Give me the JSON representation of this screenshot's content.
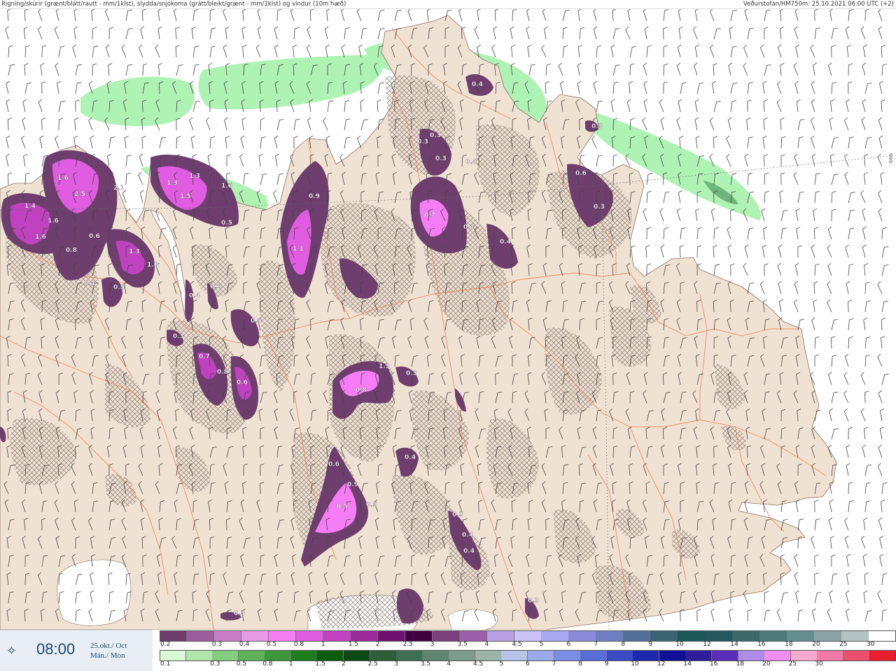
{
  "header": {
    "left": "Rigning/skúrir (grænt/blátt/rautt - mm/1klst), slydda/snjókoma (grátt/bleikt/grænt - mm/1klst) og vindur (10m hæð)",
    "right": "Veðurstofan/HM750m: 25.10.2021 06:00 UTC (+2)"
  },
  "lat_label": "66N",
  "time": {
    "icon": "sun-compass-icon",
    "clock": "08:00",
    "date_line1": "25.okt./ Oct",
    "date_line2": "Mán./ Mon"
  },
  "colors": {
    "land": "#f0e2d3",
    "sea": "#ffffff",
    "rain_green": "#aef2b4",
    "snow_purple": "#b24ac8",
    "roads": "#f07a4e"
  },
  "legend_snow": {
    "colors": [
      "#6e3f6e",
      "#9b5d9b",
      "#c77ec7",
      "#e59be5",
      "#f77df7",
      "#e05ce0",
      "#c042c0",
      "#9b2a9b",
      "#6e116e",
      "#410041",
      "#7b3f7b",
      "#9a5fa8",
      "#b8a0e2",
      "#c9c3f6",
      "#a8a8ef",
      "#8a8ad8",
      "#6e7fc1",
      "#53709b",
      "#3b6473",
      "#1e5758",
      "#25575f",
      "#3c6868",
      "#4f7a7a",
      "#658e8e",
      "#8ba3a3",
      "#b3c2c2",
      "#ffffff"
    ],
    "labels": [
      "0.2",
      "0.3",
      "0.4",
      "0.5",
      "0.8",
      "1",
      "1.5",
      "2",
      "2.5",
      "3",
      "3.5",
      "4",
      "4.5",
      "5",
      "6",
      "7",
      "8",
      "9",
      "10",
      "12",
      "14",
      "16",
      "18",
      "20",
      "25",
      "30"
    ]
  },
  "legend_rain": {
    "colors": [
      "#d8fbd6",
      "#b1e6ab",
      "#86cc80",
      "#5fb159",
      "#3e963a",
      "#1f7c1f",
      "#0d5c0d",
      "#0a4a14",
      "#2f5e3a",
      "#3e6f52",
      "#5d8670",
      "#7d9c8e",
      "#9bb3a8",
      "#b7c4e8",
      "#9aa9ec",
      "#7b8ee6",
      "#5a6ed8",
      "#3a4bc6",
      "#1c28b0",
      "#0e1196",
      "#2f1d9e",
      "#5a2eb8",
      "#b08be6",
      "#ef8ef0",
      "#f6a9d0",
      "#f27ba6",
      "#ef4f6e",
      "#e81e2a"
    ],
    "labels": [
      "0.1",
      "0.3",
      "0.5",
      "0.8",
      "1",
      "1.5",
      "2",
      "2.5",
      "3",
      "3.5",
      "4",
      "4.5",
      "5",
      "6",
      "7",
      "8",
      "9",
      "10",
      "12",
      "14",
      "16",
      "18",
      "20",
      "25",
      "30"
    ]
  },
  "precip_labels": [
    "1.6",
    "2.5",
    "2.1",
    "1.4",
    "1.6",
    "1.6",
    "0.6",
    "0.8",
    "1.3",
    "1.5",
    "1.3",
    "1.6",
    "0.5",
    "0.9",
    "1.1",
    "0.3",
    "0.3",
    "0.3",
    "0.7",
    "0.4",
    "0.7",
    "0.4",
    "0.6",
    "0.3",
    "0.3",
    "1.3",
    "1.0",
    "0.4",
    "0.5",
    "0.4",
    "0.5",
    "0.3",
    "0.7",
    "0.8",
    "0.6",
    "0.8",
    "1.3",
    "0.3",
    "0.4",
    "0.6",
    "0.9",
    "0.5",
    "0.5",
    "0.3",
    "0.4",
    "0.4",
    "0.3",
    "0.3",
    "0.4",
    "0.6"
  ]
}
